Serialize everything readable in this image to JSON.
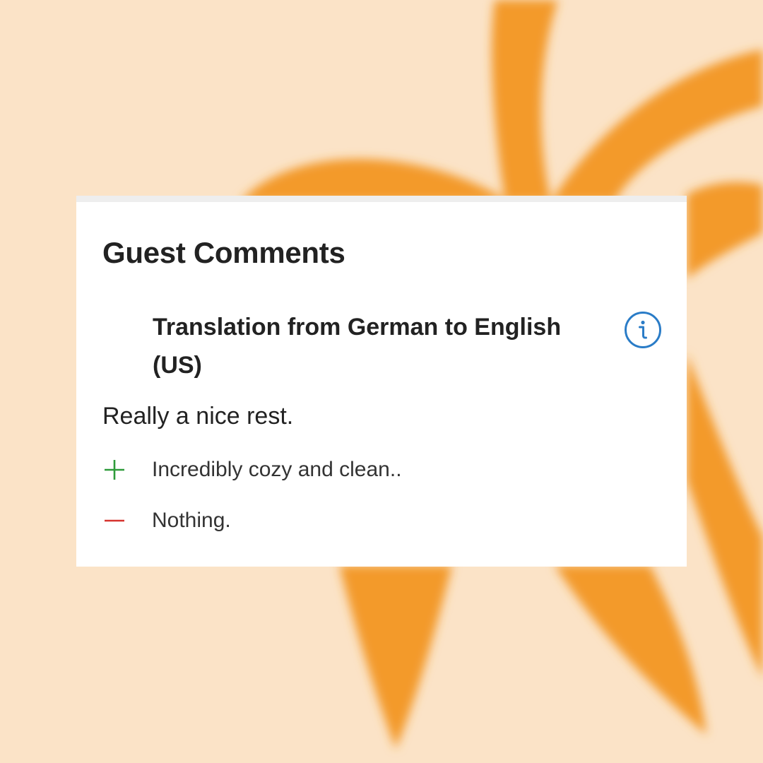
{
  "colors": {
    "background": "#fbe3c7",
    "accent_orange": "#f39a2c",
    "card": "#ffffff",
    "info_blue": "#2a7cc7",
    "positive_green": "#2e9b3a",
    "negative_red": "#d6332e"
  },
  "card": {
    "title": "Guest Comments",
    "translation_note": "Translation from German to English (US)",
    "info_icon": "info-circle-icon",
    "headline": "Really a nice rest.",
    "positive": {
      "icon": "plus-icon",
      "text": "Incredibly cozy and clean.."
    },
    "negative": {
      "icon": "minus-icon",
      "text": "Nothing."
    }
  }
}
